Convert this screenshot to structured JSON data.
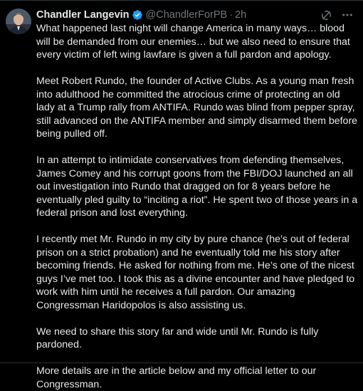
{
  "post": {
    "author_name": "Chandler Langevin",
    "handle": "@ChandlerForPB",
    "separator": "·",
    "time": "2h",
    "icons": {
      "verified": "verified-badge-icon",
      "grok": "grok-icon",
      "more": "more-icon"
    },
    "colors": {
      "verified": "#1d9bf0",
      "muted": "#71767b",
      "text": "#e7e9ea",
      "background": "#000000"
    },
    "paragraphs": [
      "What happened last night will change America in many ways… blood will be demanded from our enemies… but we also need to ensure that every victim of left wing lawfare is given a full pardon and apology.",
      "Meet Robert Rundo, the founder of Active Clubs. As a young man fresh into adulthood he committed the atrocious crime of protecting an old lady at a Trump rally from ANTIFA. Rundo was blind from pepper spray, still advanced on the ANTIFA member and simply disarmed them before being pulled off.",
      "In an attempt to intimidate conservatives from defending themselves, James Comey and his corrupt goons from the FBI/DOJ launched an all out investigation into Rundo that dragged on for 8 years before he eventually pled guilty to “inciting a riot”. He spent two of those years in a federal prison and lost everything.",
      "I recently met Mr. Rundo in my city by pure chance (he’s out of federal prison on a strict probation) and he eventually told me his story after becoming friends. He asked for nothing from me. He’s one of the nicest guys I’ve met too. I took this as a divine encounter and have pledged to work with him until he receives a full pardon. Our amazing Congressman Haridopolos is also assisting us.",
      "We need to share this story far and wide until Mr. Rundo is fully pardoned.",
      "More details are in the article below and my official letter to our Congressman."
    ]
  }
}
